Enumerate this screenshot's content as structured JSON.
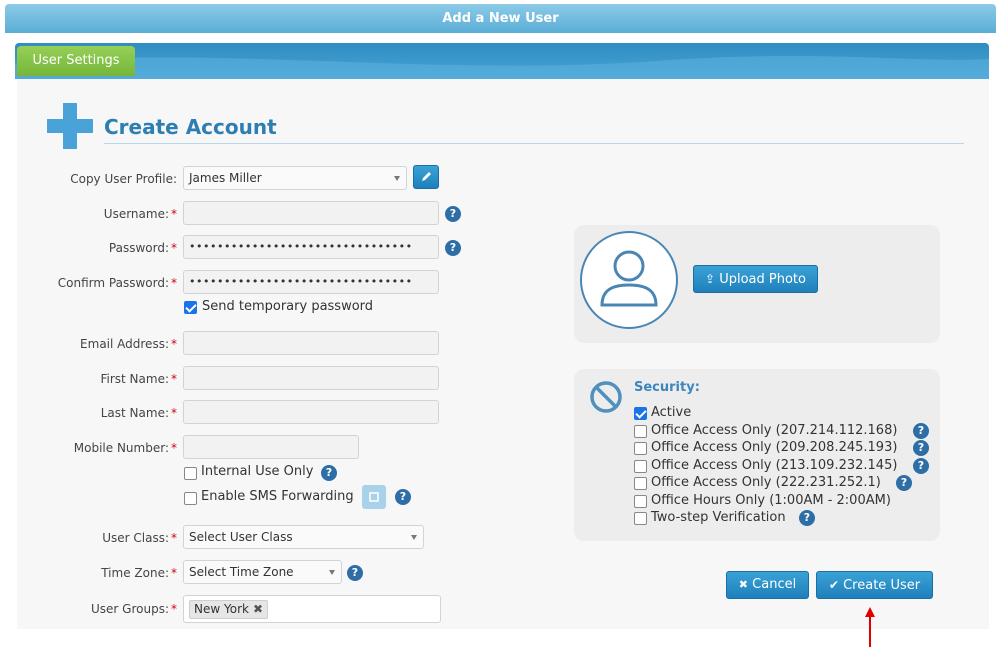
{
  "window": {
    "title": "Add a New User"
  },
  "tabs": [
    {
      "label": "User Settings"
    }
  ],
  "section": {
    "title": "Create Account"
  },
  "form": {
    "copy_profile": {
      "label": "Copy User Profile:",
      "value": "James Miller"
    },
    "username": {
      "label": "Username:",
      "value": ""
    },
    "password": {
      "label": "Password:",
      "value": "••••••••••••••••••••••••••••••••"
    },
    "confirm_password": {
      "label": "Confirm Password:",
      "value": "••••••••••••••••••••••••••••••••"
    },
    "send_temp_password": {
      "label": "Send temporary password",
      "checked": true
    },
    "email": {
      "label": "Email Address:",
      "value": ""
    },
    "first_name": {
      "label": "First Name:",
      "value": ""
    },
    "last_name": {
      "label": "Last Name:",
      "value": ""
    },
    "mobile": {
      "label": "Mobile Number:",
      "value": ""
    },
    "internal_use": {
      "label": "Internal Use Only",
      "checked": false
    },
    "sms_forwarding": {
      "label": "Enable SMS Forwarding",
      "checked": false
    },
    "user_class": {
      "label": "User Class:",
      "value": "Select User Class"
    },
    "time_zone": {
      "label": "Time Zone:",
      "value": "Select Time Zone"
    },
    "user_groups": {
      "label": "User Groups:",
      "tags": [
        "New York"
      ]
    },
    "required_mark": "*",
    "help_mark": "?"
  },
  "photo": {
    "upload_label": "Upload Photo"
  },
  "security": {
    "title": "Security:",
    "options": [
      {
        "label": "Active",
        "checked": true,
        "help": false
      },
      {
        "label": "Office Access Only (207.214.112.168)",
        "checked": false,
        "help": true
      },
      {
        "label": "Office Access Only (209.208.245.193)",
        "checked": false,
        "help": true
      },
      {
        "label": "Office Access Only (213.109.232.145)",
        "checked": false,
        "help": true
      },
      {
        "label": "Office Access Only (222.231.252.1)",
        "checked": false,
        "help": true
      },
      {
        "label": "Office Hours Only (1:00AM - 2:00AM)",
        "checked": false,
        "help": false
      },
      {
        "label": "Two-step Verification",
        "checked": false,
        "help": true
      }
    ]
  },
  "actions": {
    "cancel_label": "Cancel",
    "create_label": "Create User"
  },
  "colors": {
    "accent": "#2d7fb3",
    "tab_green": "#7bbb40",
    "button_blue": "#2b8fc8",
    "required": "#d0021b",
    "arrow": "#e00000"
  }
}
